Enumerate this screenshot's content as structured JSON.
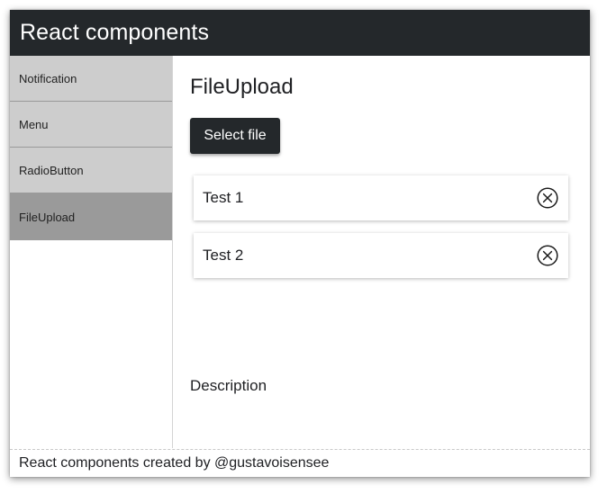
{
  "header": {
    "title": "React components"
  },
  "sidebar": {
    "items": [
      {
        "label": "Notification"
      },
      {
        "label": "Menu"
      },
      {
        "label": "RadioButton"
      },
      {
        "label": "FileUpload"
      }
    ],
    "active": "FileUpload"
  },
  "main": {
    "title": "FileUpload",
    "select_button_label": "Select file",
    "files": [
      {
        "name": "Test 1",
        "remove_icon": "close-circle-icon"
      },
      {
        "name": "Test 2",
        "remove_icon": "close-circle-icon"
      }
    ],
    "description": "Description"
  },
  "footer": {
    "text": "React components created by @gustavoisensee"
  },
  "colors": {
    "header_bg": "#24282b",
    "sidebar_item_bg": "#cdcdcd",
    "sidebar_item_active_bg": "#9a9a9a",
    "button_bg": "#24282b"
  }
}
